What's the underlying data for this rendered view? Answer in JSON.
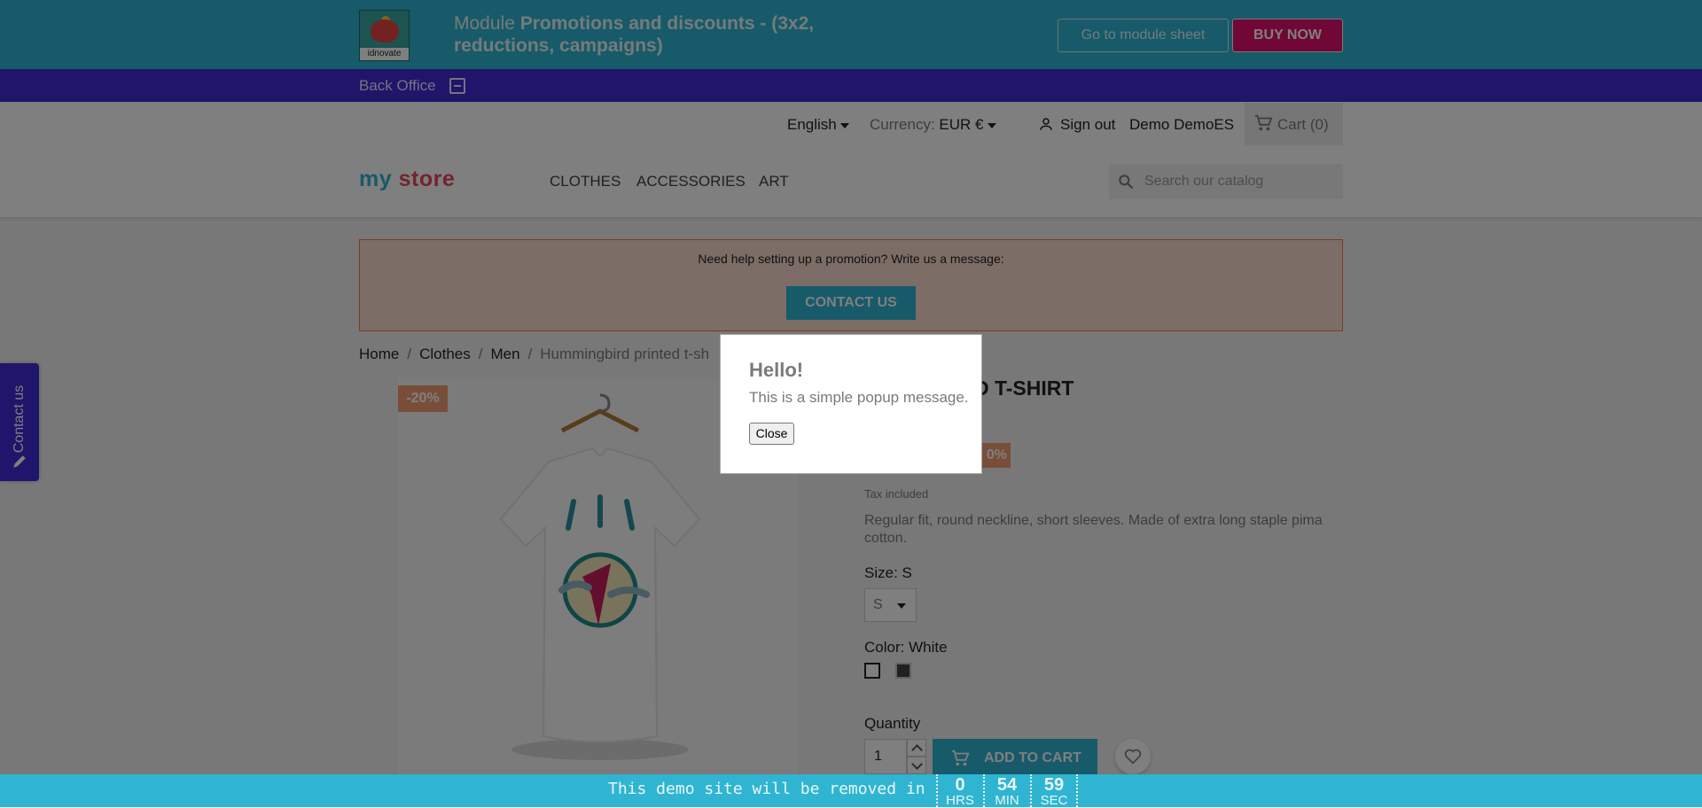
{
  "promo": {
    "module_prefix": "Module",
    "module_name": "Promotions and discounts - (3x2, reductions, campaigns)",
    "logo_text": "idnovate",
    "sheet_button": "Go to module sheet",
    "buy_button": "BUY NOW"
  },
  "backoffice": {
    "label": "Back Office"
  },
  "topnav": {
    "language": "English",
    "currency_label": "Currency:",
    "currency_value": "EUR €",
    "signout": "Sign out",
    "username": "Demo DemoES",
    "cart": "Cart (0)"
  },
  "header": {
    "logo_part1": "my",
    "logo_part2": "store",
    "categories": [
      "CLOTHES",
      "ACCESSORIES",
      "ART"
    ],
    "search_placeholder": "Search our catalog"
  },
  "help": {
    "text": "Need help setting up a promotion? Write us a message:",
    "button": "CONTACT US"
  },
  "breadcrumb": [
    "Home",
    "Clothes",
    "Men",
    "Hummingbird printed t-sh"
  ],
  "product": {
    "discount_badge": "-20%",
    "title_visible": "RD PRINTED T-SHIRT",
    "price_badge_visible": "0%",
    "tax": "Tax included",
    "description": "Regular fit, round neckline, short sleeves. Made of extra long staple pima cotton.",
    "size_label": "Size: S",
    "size_value": "S",
    "color_label": "Color: White",
    "quantity_label": "Quantity",
    "quantity_value": "1",
    "add_to_cart": "ADD TO CART"
  },
  "side_tab": {
    "label": "Contact us"
  },
  "popup": {
    "title": "Hello!",
    "message": "This is a simple popup message.",
    "close": "Close"
  },
  "countdown": {
    "text": "This demo site will be removed in",
    "hours": "0",
    "hours_unit": "HRS",
    "minutes": "54",
    "minutes_unit": "MIN",
    "seconds": "59",
    "seconds_unit": "SEC"
  },
  "colors": {
    "teal": "#2fb5d2",
    "indigo": "#3f2bd6",
    "pink": "#e00f6d",
    "discount": "#f39d72",
    "help_bg": "#f9dbcc"
  }
}
